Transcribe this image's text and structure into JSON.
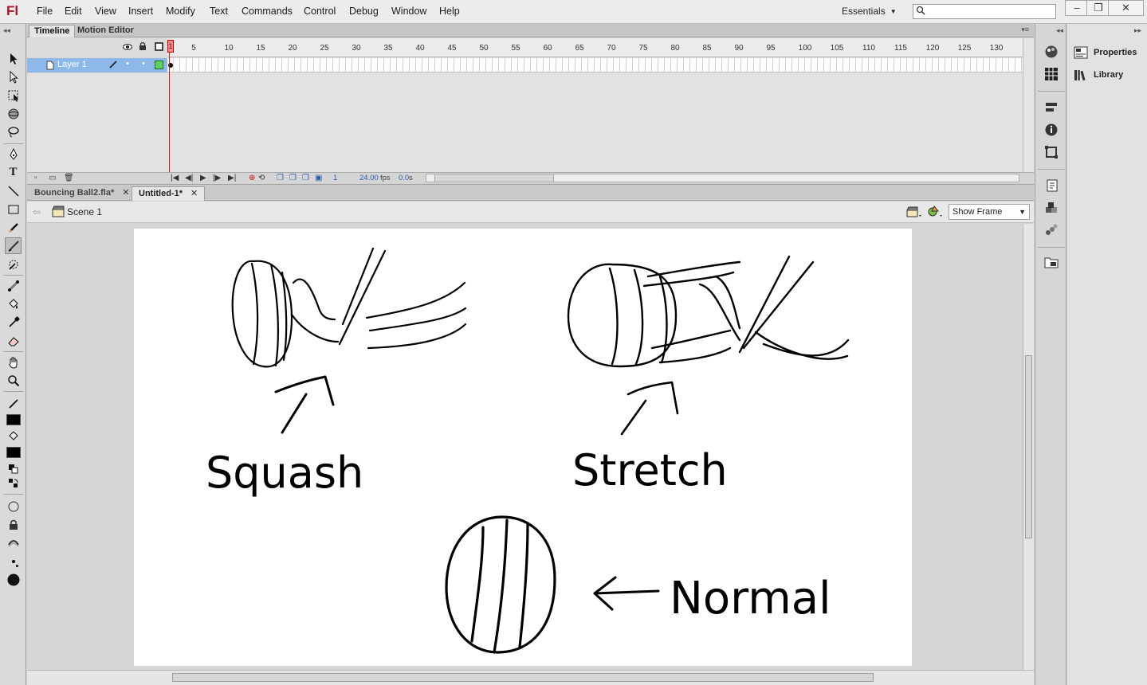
{
  "app": {
    "logo": "Fl",
    "menu": [
      "File",
      "Edit",
      "View",
      "Insert",
      "Modify",
      "Text",
      "Commands",
      "Control",
      "Debug",
      "Window",
      "Help"
    ],
    "workspace": "Essentials",
    "search": {
      "placeholder": "",
      "value": ""
    },
    "window_buttons": [
      "minimize",
      "restore",
      "close"
    ]
  },
  "timeline": {
    "tabs": [
      "Timeline",
      "Motion Editor"
    ],
    "active_tab": "Timeline",
    "ruler_numbers": [
      "1",
      "5",
      "10",
      "15",
      "20",
      "25",
      "30",
      "35",
      "40",
      "45",
      "50",
      "55",
      "60",
      "65",
      "70",
      "75",
      "80",
      "85",
      "90",
      "95",
      "100",
      "105",
      "110",
      "115",
      "120",
      "125",
      "130"
    ],
    "layers": [
      {
        "name": "Layer 1",
        "color": "#5fd35f",
        "selected": true
      }
    ],
    "current_frame": "1",
    "fps": "24.00",
    "fps_unit": "fps",
    "elapsed": "0.0",
    "elapsed_unit": "s"
  },
  "documents": {
    "tabs": [
      {
        "label": "Bouncing Ball2.fla*",
        "active": false
      },
      {
        "label": "Untitled-1*",
        "active": true
      }
    ]
  },
  "editbar": {
    "scene": "Scene 1",
    "zoom_options": [
      "Show Frame"
    ],
    "zoom": "Show Frame"
  },
  "stage": {
    "background": "#ffffff",
    "drawing_labels": [
      "Squash",
      "Stretch",
      "Normal"
    ]
  },
  "dock": {
    "panels": [
      "Properties",
      "Library"
    ]
  },
  "colors": {
    "stroke": "#000000",
    "fill": "#000000",
    "playhead": "#d41a1a",
    "selected_layer": "#8cb8ea"
  }
}
